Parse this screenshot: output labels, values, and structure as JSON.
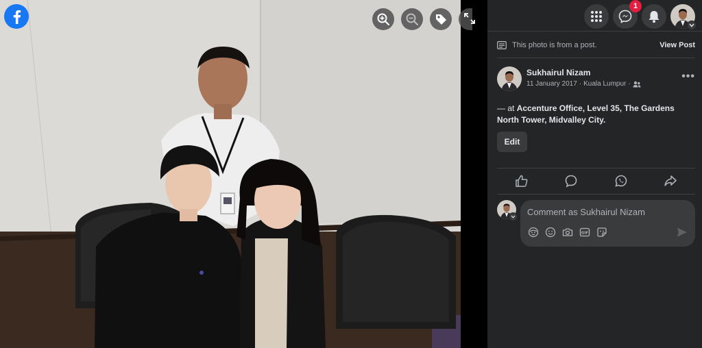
{
  "viewer": {
    "logo": "facebook-logo",
    "controls": [
      "zoom-in-icon",
      "zoom-out-icon",
      "tag-icon",
      "fullscreen-icon"
    ]
  },
  "topnav": {
    "menu_icon": "grid-menu-icon",
    "messenger_icon": "messenger-icon",
    "messenger_badge": "1",
    "notifications_icon": "bell-icon"
  },
  "post": {
    "from_post_text": "This photo is from a post.",
    "view_post_label": "View Post",
    "author_name": "Sukhairul Nizam",
    "date": "11 January 2017",
    "dot": "·",
    "location": "Kuala Lumpur",
    "dot2": "·",
    "text_prefix": "— at ",
    "text_place": "Accenture Office, Level 35, The Gardens North Tower, Midvalley City.",
    "edit_label": "Edit",
    "more_label": "•••"
  },
  "actions": [
    "like-icon",
    "comment-icon",
    "whatsapp-icon",
    "share-icon"
  ],
  "comment": {
    "placeholder": "Comment as Sukhairul Nizam",
    "icons": [
      "avatar-sticker-icon",
      "emoji-icon",
      "camera-icon",
      "gif-icon",
      "sticker-icon"
    ]
  },
  "colors": {
    "panel_bg": "#242526",
    "surface": "#3a3b3c",
    "text_primary": "#e4e6eb",
    "text_secondary": "#b0b3b8",
    "badge_red": "#e41e3f",
    "brand_blue": "#1877f2"
  }
}
